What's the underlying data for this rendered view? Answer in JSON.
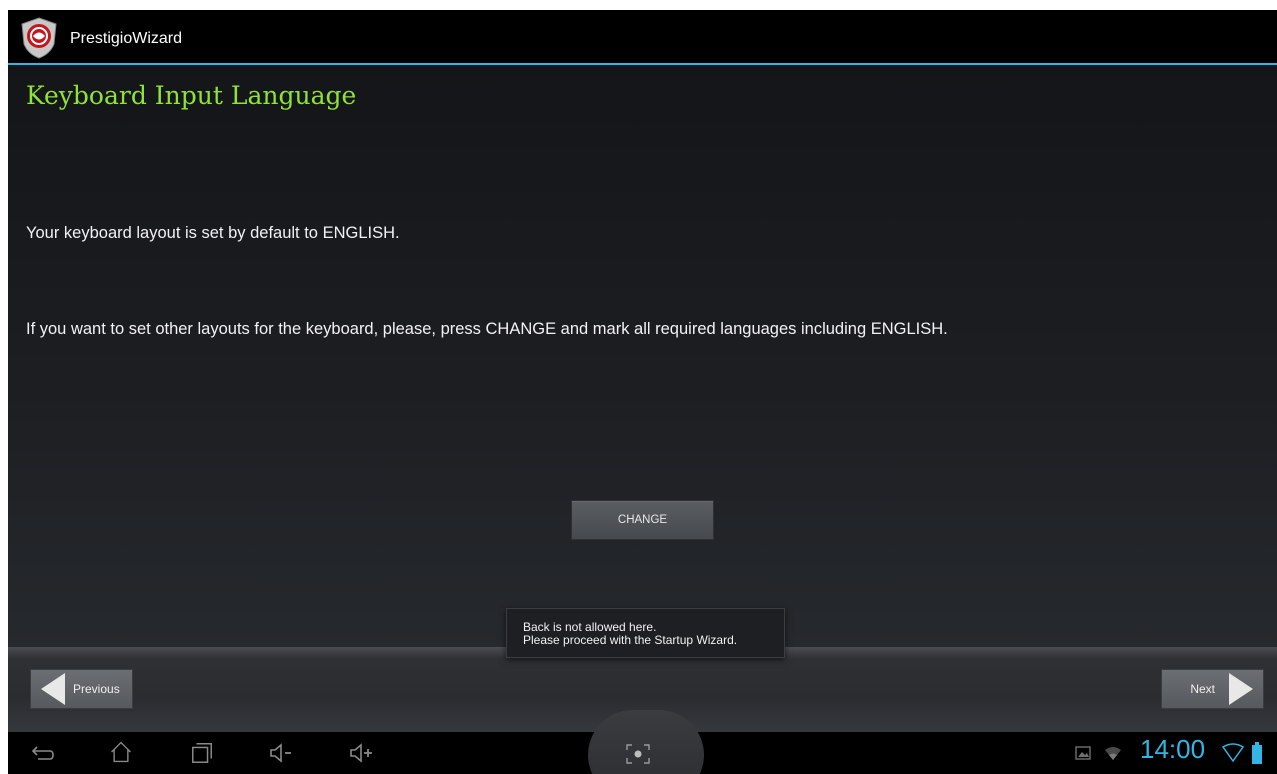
{
  "app": {
    "title": "PrestigioWizard"
  },
  "page": {
    "heading": "Keyboard Input Language",
    "paragraph1": "Your keyboard layout is set by default to ENGLISH.",
    "paragraph2": "If you want to set other layouts for the keyboard, please, press CHANGE and mark all required languages including ENGLISH.",
    "change_label": "CHANGE"
  },
  "toast": {
    "line1": "Back is not allowed here.",
    "line2": "Please proceed with the Startup Wizard."
  },
  "navigation": {
    "previous_label": "Previous",
    "next_label": "Next"
  },
  "status": {
    "time": "14:00"
  },
  "system_icons": [
    "back-icon",
    "home-icon",
    "recent-apps-icon",
    "volume-down-icon",
    "volume-up-icon",
    "screenshot-icon",
    "gallery-notification-icon",
    "wifi-icon",
    "battery-icon"
  ],
  "colors": {
    "accent": "#33b5e5",
    "heading": "#8ee23a"
  }
}
